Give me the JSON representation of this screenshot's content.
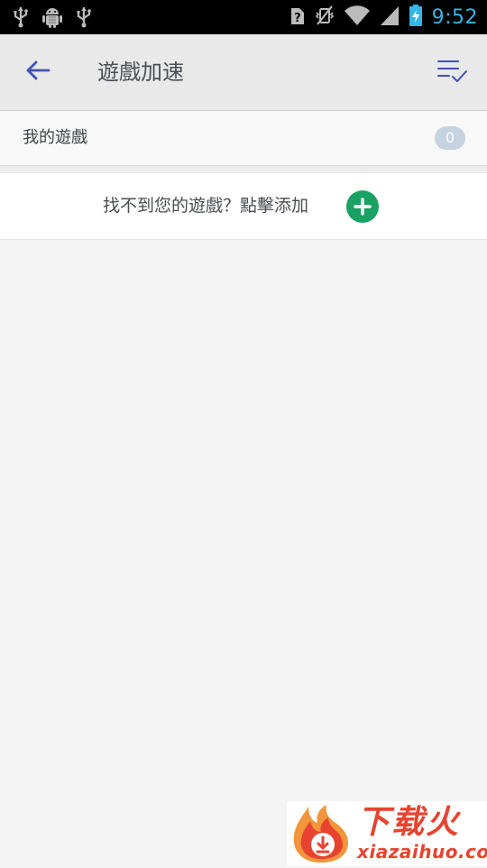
{
  "status_bar": {
    "time": "9:52",
    "left_icons": [
      "usb-icon",
      "android-debug-icon",
      "usb-icon"
    ],
    "right_icons": [
      "sim-unknown-icon",
      "vibrate-off-icon",
      "wifi-icon",
      "signal-icon",
      "battery-charging-icon"
    ],
    "time_color": "#33b5e5"
  },
  "toolbar": {
    "title": "遊戲加速",
    "back_icon": "arrow-left-icon",
    "select_icon": "list-check-icon",
    "accent": "#3f51b5"
  },
  "my_games": {
    "label": "我的遊戲",
    "count": "0"
  },
  "add_game": {
    "label": "找不到您的遊戲？點擊添加",
    "plus_icon": "plus-circle-icon",
    "plus_color": "#1aa164"
  },
  "watermark": {
    "brand": "下载火",
    "url": "xiazaihuo.com",
    "color": "#e8432f"
  }
}
